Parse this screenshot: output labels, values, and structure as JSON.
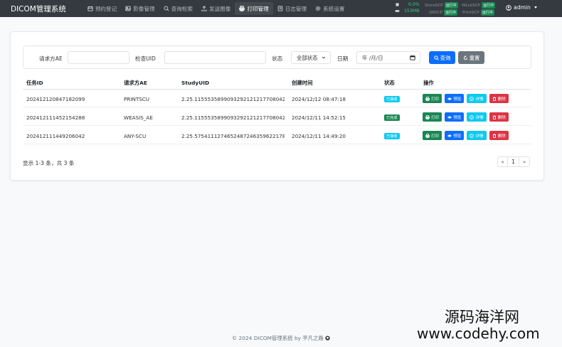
{
  "app": {
    "brand": "DICOM管理系统"
  },
  "nav": [
    {
      "label": "预约登记",
      "icon": "calendar-icon",
      "active": false
    },
    {
      "label": "影像管理",
      "icon": "image-icon",
      "active": false
    },
    {
      "label": "查询检索",
      "icon": "search-icon",
      "active": false
    },
    {
      "label": "发送图像",
      "icon": "upload-icon",
      "active": false
    },
    {
      "label": "打印管理",
      "icon": "printer-icon",
      "active": true
    },
    {
      "label": "日志管理",
      "icon": "journal-icon",
      "active": false
    },
    {
      "label": "系统设置",
      "icon": "gear-icon",
      "active": false
    }
  ],
  "system": {
    "cpu": "0.0%",
    "memory": "153MB",
    "services": [
      {
        "name": "StoreSCP",
        "status": "运行中"
      },
      {
        "name": "WListSCP",
        "status": "运行中"
      },
      {
        "name": "QRSCP",
        "status": "运行中"
      },
      {
        "name": "PrintSCP",
        "status": "运行中"
      }
    ]
  },
  "user": {
    "name": "admin"
  },
  "filters": {
    "caller_ae_label": "请求方AE",
    "caller_ae_value": "",
    "study_uid_label": "检查UID",
    "study_uid_value": "",
    "status_label": "状态",
    "status_value": "全部状态",
    "date_label": "日期",
    "date_placeholder": "年 /月/日",
    "search_button": "查询",
    "reset_button": "重置"
  },
  "table": {
    "columns": [
      "任务ID",
      "请求方AE",
      "StudyUID",
      "创建时间",
      "状态",
      "操作"
    ],
    "rows": [
      {
        "task_id": "202412120847182099",
        "caller_ae": "PRINTSCU",
        "study_uid": "2.25.1155535899093292121217708042315...",
        "created": "2024/12/12 08:47:18",
        "status": "已接收",
        "status_color": "#0dcaf0"
      },
      {
        "task_id": "202412111452154288",
        "caller_ae": "WEASIS_AE",
        "study_uid": "2.25.1155535899093292121217708042315...",
        "created": "2024/12/11 14:52:15",
        "status": "已完成",
        "status_color": "#198754"
      },
      {
        "task_id": "202412111449206042",
        "caller_ae": "ANY-SCU",
        "study_uid": "2.25.5754111274652487246359622178503...",
        "created": "2024/12/11 14:49:20",
        "status": "已接收",
        "status_color": "#0dcaf0"
      }
    ],
    "actions": [
      {
        "label": "打印",
        "icon": "printer-icon",
        "color": "#198754"
      },
      {
        "label": "预览",
        "icon": "eye-icon",
        "color": "#0d6efd"
      },
      {
        "label": "详情",
        "icon": "info-icon",
        "color": "#0dcaf0"
      },
      {
        "label": "删除",
        "icon": "trash-icon",
        "color": "#dc3545"
      }
    ]
  },
  "summary": "显示 1-3 条，共 3 条",
  "pagination": {
    "prev": "«",
    "current": "1",
    "next": "»"
  },
  "footer": {
    "text": "© 2024 DICOM管理系统 by 平凡之路"
  },
  "watermark": {
    "line1": "源码海洋网",
    "line2": "www.codehy.com"
  },
  "colors": {
    "navbar": "#343a40",
    "primary": "#0d6efd",
    "secondary": "#6c757d",
    "success": "#198754",
    "info": "#0dcaf0",
    "danger": "#dc3545"
  }
}
